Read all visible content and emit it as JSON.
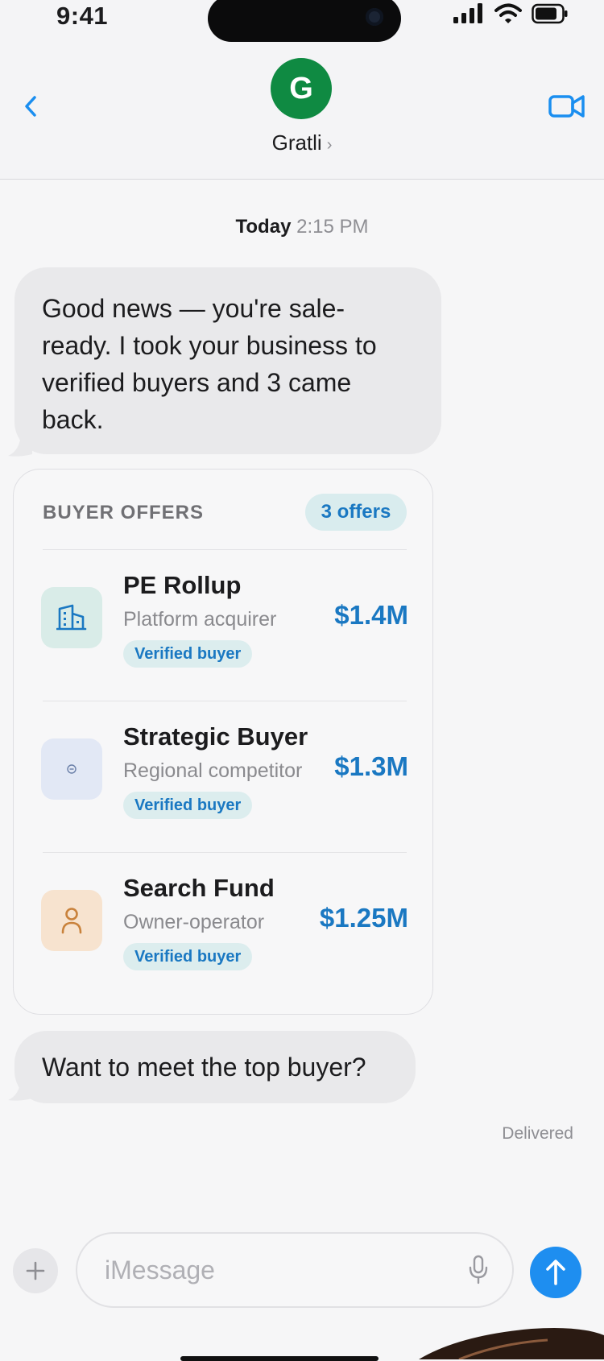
{
  "status": {
    "time": "9:41"
  },
  "header": {
    "back_icon": "chevron-left-icon",
    "avatar_letter": "G",
    "contact_name": "Gratli",
    "contact_chevron": "›",
    "video_icon": "video-camera-icon",
    "accent": "#1a8ef0",
    "avatar_color": "#0f8a42"
  },
  "thread": {
    "timestamp_day": "Today",
    "timestamp_time": "2:15 PM",
    "message1": "Good news — you're sale-ready. I took your business to verified buyers and 3 came back.",
    "message2": "Want to meet the top buyer?",
    "delivered": "Delivered"
  },
  "card": {
    "title": "BUYER OFFERS",
    "badge": "3 offers",
    "offers": [
      {
        "name": "PE Rollup",
        "subtitle": "Platform acquirer",
        "verified": "Verified buyer",
        "amount": "$1.4M",
        "icon": "building-icon",
        "icon_bg": "#d9ece8"
      },
      {
        "name": "Strategic Buyer",
        "subtitle": "Regional competitor",
        "verified": "Verified buyer",
        "amount": "$1.3M",
        "icon": "target-icon",
        "icon_bg": "#e2e8f5"
      },
      {
        "name": "Search Fund",
        "subtitle": "Owner-operator",
        "verified": "Verified buyer",
        "amount": "$1.25M",
        "icon": "person-icon",
        "icon_bg": "#f7e3cf"
      }
    ]
  },
  "composer": {
    "placeholder": "iMessage",
    "plus_icon": "plus-icon",
    "mic_icon": "microphone-icon",
    "send_icon": "arrow-up-icon"
  }
}
